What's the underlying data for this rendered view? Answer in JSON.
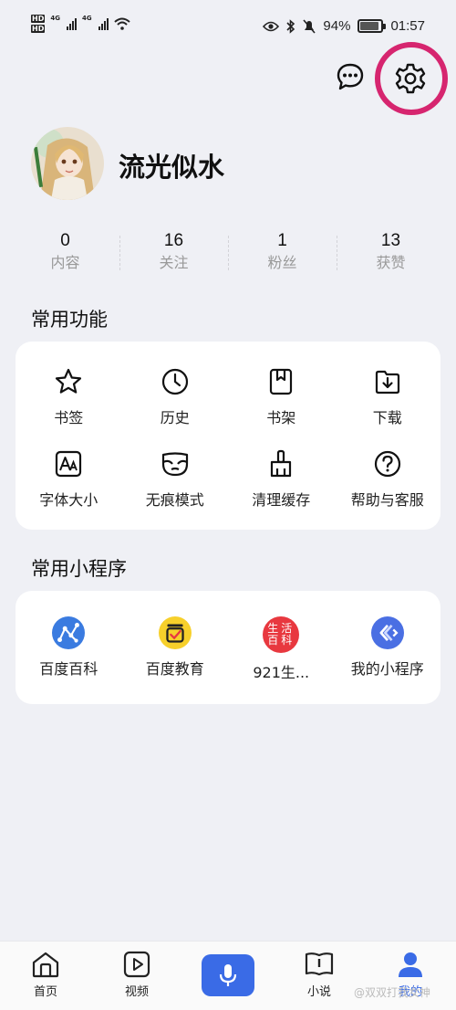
{
  "status_bar": {
    "time": "01:57",
    "battery": "94%",
    "network_label_1": "4G",
    "network_label_2": "4G",
    "hd_label": "HD"
  },
  "header": {
    "message_icon": "chat-bubble-icon",
    "settings_icon": "gear-icon",
    "highlight_color": "#d6256f"
  },
  "profile": {
    "username": "流光似水"
  },
  "stats": [
    {
      "value": "0",
      "label": "内容"
    },
    {
      "value": "16",
      "label": "关注"
    },
    {
      "value": "1",
      "label": "粉丝"
    },
    {
      "value": "13",
      "label": "获赞"
    }
  ],
  "common_functions": {
    "title": "常用功能",
    "items": [
      {
        "label": "书签",
        "icon": "star-icon"
      },
      {
        "label": "历史",
        "icon": "clock-icon"
      },
      {
        "label": "书架",
        "icon": "bookshelf-icon"
      },
      {
        "label": "下载",
        "icon": "download-icon"
      },
      {
        "label": "字体大小",
        "icon": "font-size-icon"
      },
      {
        "label": "无痕模式",
        "icon": "mask-icon"
      },
      {
        "label": "清理缓存",
        "icon": "broom-icon"
      },
      {
        "label": "帮助与客服",
        "icon": "help-icon"
      }
    ]
  },
  "mini_programs": {
    "title": "常用小程序",
    "items": [
      {
        "label": "百度百科",
        "icon": "baike-icon",
        "color": "#3a7be0"
      },
      {
        "label": "百度教育",
        "icon": "education-icon",
        "color": "#f7d02b"
      },
      {
        "label": "921生...",
        "icon": "life-encyclopedia-icon",
        "color": "#e8383f",
        "icon_text_1": "生活",
        "icon_text_2": "百科"
      },
      {
        "label": "我的小程序",
        "icon": "mini-program-icon",
        "color": "#4a6fe3"
      }
    ]
  },
  "bottom_nav": {
    "accent": "#3a6be6",
    "items": [
      {
        "label": "首页",
        "icon": "home-icon"
      },
      {
        "label": "视频",
        "icon": "video-icon"
      },
      {
        "label": "",
        "icon": "microphone-icon"
      },
      {
        "label": "小说",
        "icon": "book-icon"
      },
      {
        "label": "我的",
        "icon": "profile-icon"
      }
    ]
  },
  "watermark": "@双双打我女神"
}
